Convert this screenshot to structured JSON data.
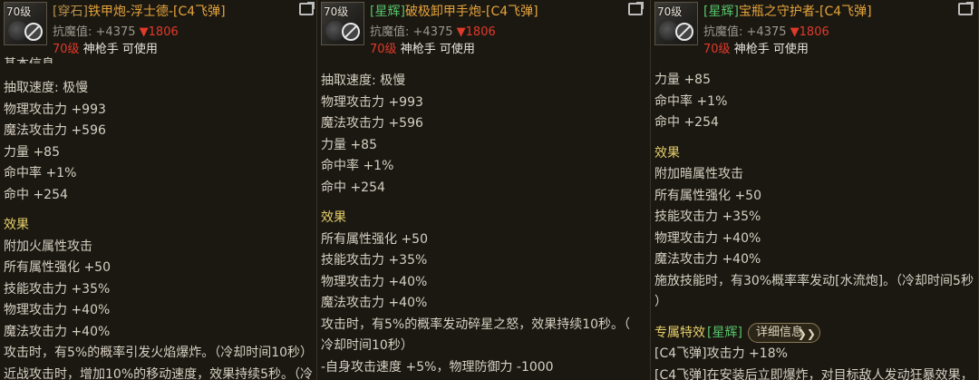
{
  "tooltips": [
    {
      "level_badge": "70级",
      "title_tag": "[穿石]",
      "title_name": "铁甲炮-浮士德-[C4飞弹]",
      "resist_label": "抗魔值:",
      "resist_value": "+4375",
      "resist_delta": "▼1806",
      "req_level": "70级",
      "req_class": "神枪手 可使用",
      "cut_text": "基本信息",
      "stats": [
        "抽取速度: 极慢",
        "物理攻击力 +993",
        "魔法攻击力 +596",
        "力量 +85",
        "命中率 +1%",
        "命中 +254"
      ],
      "effects_heading": "效果",
      "effects": [
        "附加火属性攻击",
        "所有属性强化 +50",
        "技能攻击力 +35%",
        "物理攻击力 +40%",
        "魔法攻击力 +40%",
        "攻击时，有5%的概率引发火焰爆炸。（冷却时间10秒）",
        "近战攻击时，增加10%的移动速度，效果持续5秒。（冷"
      ]
    },
    {
      "level_badge": "70级",
      "title_tag": "[星辉]",
      "title_name": "破极卸甲手炮-[C4飞弹]",
      "resist_label": "抗魔值:",
      "resist_value": "+4375",
      "resist_delta": "▼1806",
      "req_level": "70级",
      "req_class": "神枪手 可使用",
      "stats": [
        "抽取速度: 极慢",
        "物理攻击力 +993",
        "魔法攻击力 +596",
        "力量 +85",
        "命中率 +1%",
        "命中 +254"
      ],
      "effects_heading": "效果",
      "effects": [
        "所有属性强化 +50",
        "技能攻击力 +35%",
        "物理攻击力 +40%",
        "魔法攻击力 +40%",
        "攻击时，有5%的概率发动碎星之怒，效果持续10秒。（",
        "冷却时间10秒）",
        "-自身攻击速度 +5%，物理防御力 -1000"
      ]
    },
    {
      "level_badge": "70级",
      "title_tag": "[星辉]",
      "title_name": "宝瓶之守护者-[C4飞弹]",
      "resist_label": "抗魔值:",
      "resist_value": "+4375",
      "resist_delta": "▼1806",
      "req_level": "70级",
      "req_class": "神枪手 可使用",
      "stats": [
        "力量 +85",
        "命中率 +1%",
        "命中 +254"
      ],
      "effects_heading": "效果",
      "effects": [
        "附加暗属性攻击",
        "所有属性强化 +50",
        "技能攻击力 +35%",
        "物理攻击力 +40%",
        "魔法攻击力 +40%",
        "施放技能时，有30%概率率发动[水流炮]。（冷却时间5秒",
        "）"
      ],
      "special_label": "专属特效",
      "special_tag": "[星辉]",
      "detail_button": "详细信息",
      "special_lines": [
        "[C4飞弹]攻击力 +18%",
        "[C4飞弹]在安装后立即爆炸，对目标敌人发动狂暴效果，"
      ]
    }
  ]
}
